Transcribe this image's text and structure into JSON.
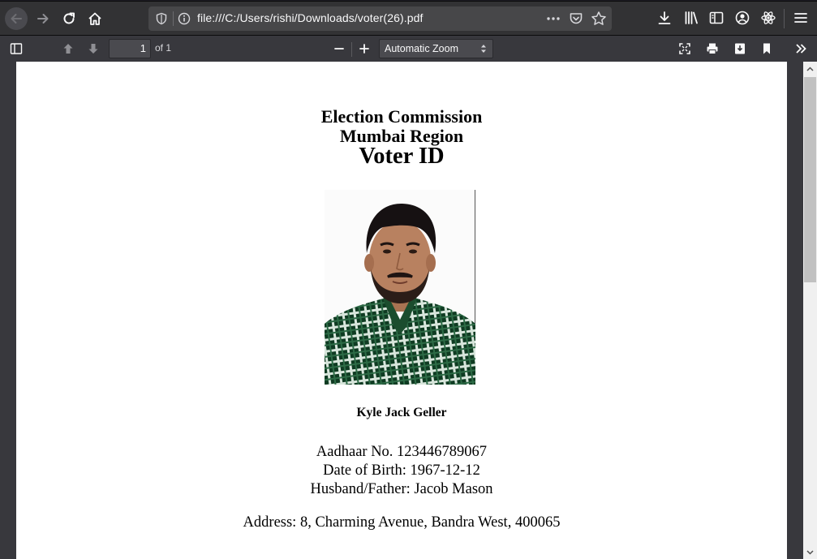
{
  "browser": {
    "url": "file:///C:/Users/rishi/Downloads/voter(26).pdf",
    "icons": {
      "back": "back-arrow-icon",
      "forward": "forward-arrow-icon",
      "reload": "reload-icon",
      "home": "home-icon",
      "shield": "tracking-shield-icon",
      "info": "info-icon",
      "page_actions": "more-dots-icon",
      "pocket": "pocket-icon",
      "bookmark_star": "star-icon",
      "downloads": "download-icon",
      "library": "library-icon",
      "sidebar": "sidebar-icon",
      "account": "account-icon",
      "extension": "react-extension-icon",
      "menu": "hamburger-menu-icon"
    }
  },
  "pdf_toolbar": {
    "page_number": "1",
    "page_count_label": "of 1",
    "zoom_value": "Automatic Zoom"
  },
  "document": {
    "heading_line1": "Election Commission",
    "heading_line2": "Mumbai Region",
    "heading_line3": "Voter ID",
    "photo_alt": "voter-photo",
    "name": "Kyle Jack Geller",
    "aadhaar": "Aadhaar No. 123446789067",
    "dob": "Date of Birth: 1967-12-12",
    "relation": "Husband/Father: Jacob Mason",
    "address": "Address: 8, Charming Avenue, Bandra West, 400065"
  },
  "colors": {
    "chrome_dark": "#323234",
    "urlbar": "#474749",
    "icon": "#f9f9fa",
    "page_bg": "#ffffff",
    "viewer_bg": "#38383d"
  }
}
